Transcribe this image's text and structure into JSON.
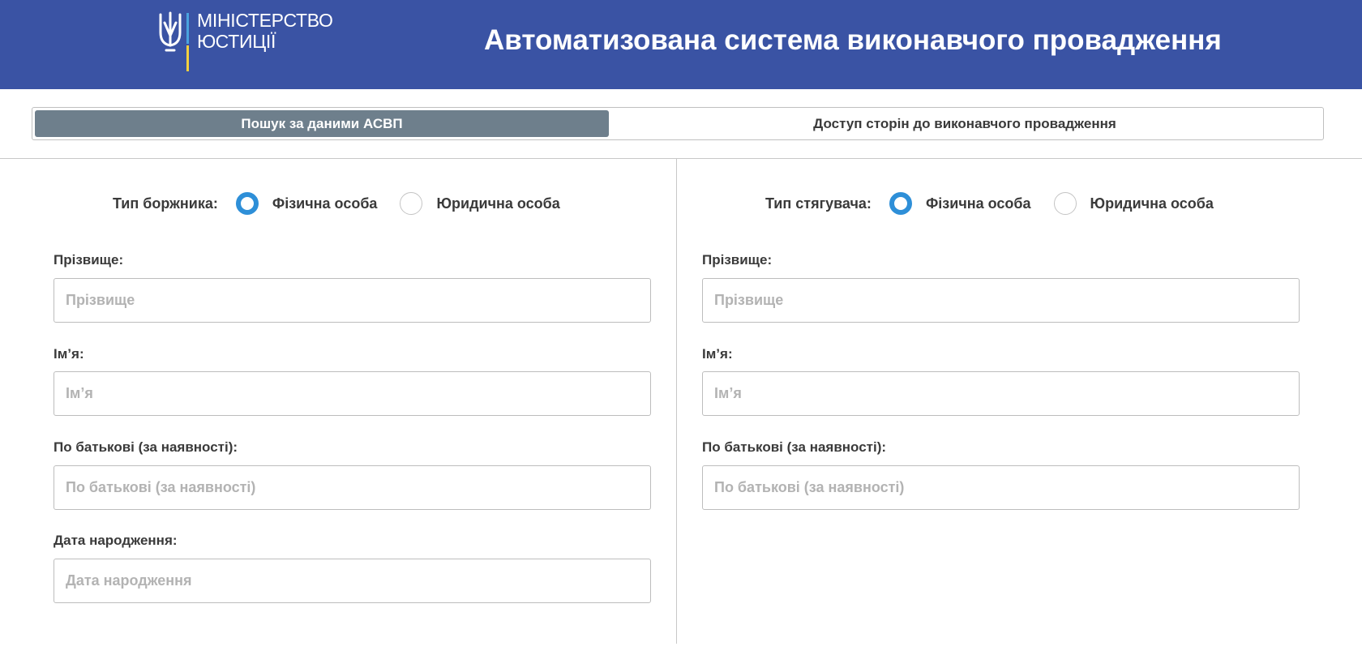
{
  "colors": {
    "header_bg": "#3a53a4",
    "tab_active_bg": "#6e7f8c",
    "radio_accent": "#2e8fd8",
    "logo_blue_bar": "#4aa3df",
    "logo_yellow_bar": "#f4d03f"
  },
  "header": {
    "logo_line1": "МІНІСТЕРСТВО",
    "logo_line2": "ЮСТИЦІЇ",
    "logo_icon": "trident-icon",
    "title": "Автоматизована система виконавчого провадження"
  },
  "tabs": [
    {
      "label": "Пошук за даними АСВП",
      "active": true
    },
    {
      "label": "Доступ сторін до виконавчого провадження",
      "active": false
    }
  ],
  "debtor": {
    "type_label": "Тип боржника:",
    "options": [
      {
        "label": "Фізична особа",
        "checked": true
      },
      {
        "label": "Юридична особа",
        "checked": false
      }
    ],
    "fields": [
      {
        "label": "Прізвище:",
        "placeholder": "Прізвище",
        "value": ""
      },
      {
        "label": "Ім’я:",
        "placeholder": "Ім’я",
        "value": ""
      },
      {
        "label": "По батькові (за наявності):",
        "placeholder": "По батькові (за наявності)",
        "value": ""
      },
      {
        "label": "Дата народження:",
        "placeholder": "Дата народження",
        "value": ""
      }
    ]
  },
  "creditor": {
    "type_label": "Тип стягувача:",
    "options": [
      {
        "label": "Фізична особа",
        "checked": true
      },
      {
        "label": "Юридична особа",
        "checked": false
      }
    ],
    "fields": [
      {
        "label": "Прізвище:",
        "placeholder": "Прізвище",
        "value": ""
      },
      {
        "label": "Ім’я:",
        "placeholder": "Ім’я",
        "value": ""
      },
      {
        "label": "По батькові (за наявності):",
        "placeholder": "По батькові (за наявності)",
        "value": ""
      }
    ]
  }
}
